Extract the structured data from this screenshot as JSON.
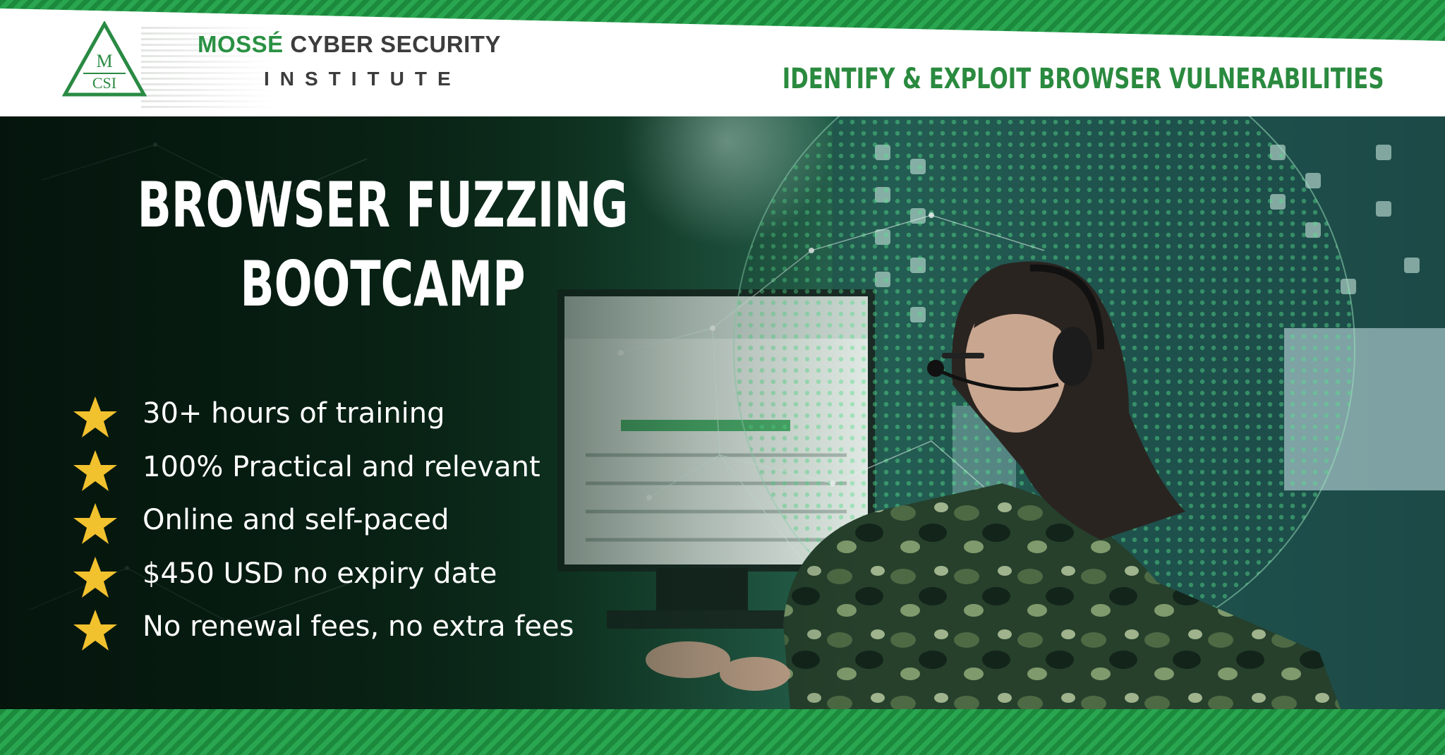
{
  "logo": {
    "mark_top": "M",
    "mark_bottom": "CSI",
    "name_part1": "MOSSÉ",
    "name_part2": "CYBER SECURITY",
    "subtitle": "INSTITUTE"
  },
  "tagline": "IDENTIFY & EXPLOIT BROWSER VULNERABILITIES",
  "title": {
    "line1": "BROWSER FUZZING",
    "line2": "BOOTCAMP"
  },
  "features": [
    "30+ hours of training",
    "100% Practical and relevant",
    "Online and self-paced",
    "$450 USD no expiry date",
    "No renewal fees, no extra fees"
  ],
  "icons": {
    "bullet": "star-icon",
    "logo": "triangle-logo-icon"
  },
  "colors": {
    "brand_green": "#2a8a43",
    "stripe_green": "#1b8a3c",
    "star_yellow": "#f2c12e",
    "text_white": "#ffffff",
    "logo_gray": "#3c3c3c"
  }
}
